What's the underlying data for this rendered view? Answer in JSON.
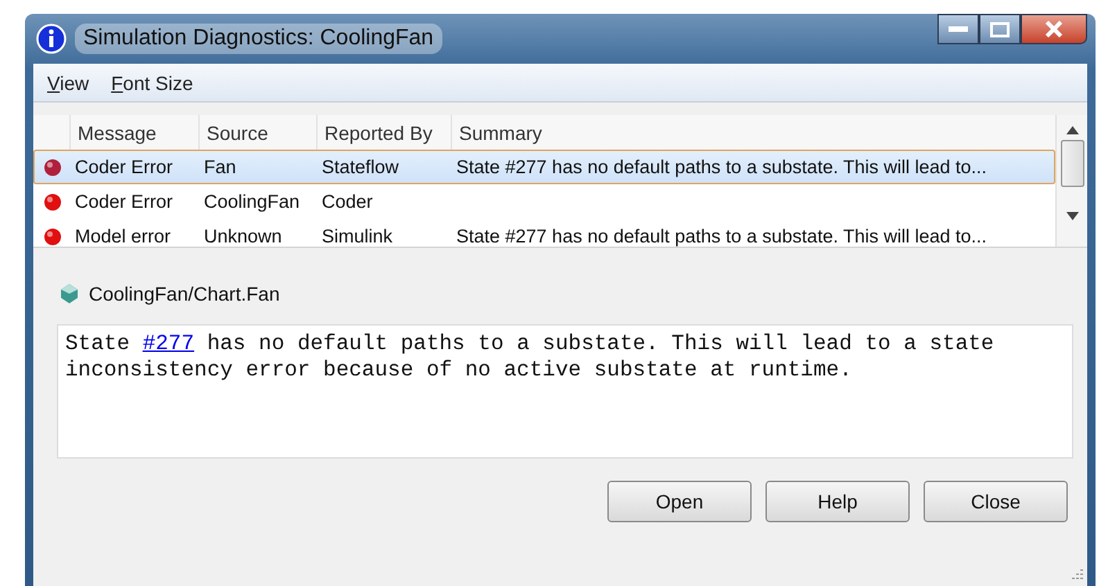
{
  "window": {
    "title": "Simulation Diagnostics: CoolingFan"
  },
  "menu": [
    {
      "label": "View"
    },
    {
      "label": "Font Size"
    }
  ],
  "table": {
    "columns": [
      "Message",
      "Source",
      "Reported By",
      "Summary"
    ],
    "rows": [
      {
        "message": "Coder Error",
        "source": "Fan",
        "reported_by": "Stateflow",
        "summary": "State #277 has no default paths to a substate. This will lead to...",
        "selected": true
      },
      {
        "message": "Coder Error",
        "source": "CoolingFan",
        "reported_by": "Coder",
        "summary": "",
        "selected": false
      },
      {
        "message": "Model error",
        "source": "Unknown",
        "reported_by": "Simulink",
        "summary": "State #277 has no default paths to a substate. This will lead to...",
        "selected": false
      }
    ]
  },
  "path": "CoolingFan/Chart.Fan",
  "detail": {
    "before": "State ",
    "link": "#277",
    "after": " has no default paths to a substate. This will lead to a state inconsistency error because of no active substate at runtime."
  },
  "buttons": [
    "Open",
    "Help",
    "Close"
  ]
}
